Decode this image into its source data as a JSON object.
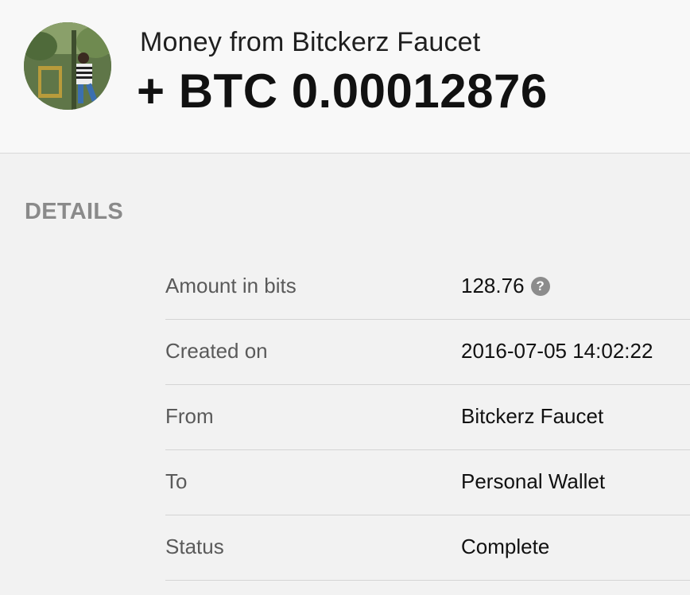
{
  "header": {
    "title": "Money from Bitckerz Faucet",
    "amount": "+ BTC 0.00012876",
    "avatar_icon": "user-avatar-photo"
  },
  "details": {
    "heading": "DETAILS",
    "help_icon_glyph": "?",
    "rows": [
      {
        "label": "Amount in bits",
        "value": "128.76"
      },
      {
        "label": "Created on",
        "value": "2016-07-05 14:02:22"
      },
      {
        "label": "From",
        "value": "Bitckerz Faucet"
      },
      {
        "label": "To",
        "value": "Personal Wallet"
      },
      {
        "label": "Status",
        "value": "Complete"
      }
    ]
  },
  "colors": {
    "background": "#f2f2f2",
    "header_background": "#f8f8f8",
    "heading_gray": "#8a8a8a",
    "label_gray": "#5a5a5a",
    "divider": "#d4d4d4"
  }
}
